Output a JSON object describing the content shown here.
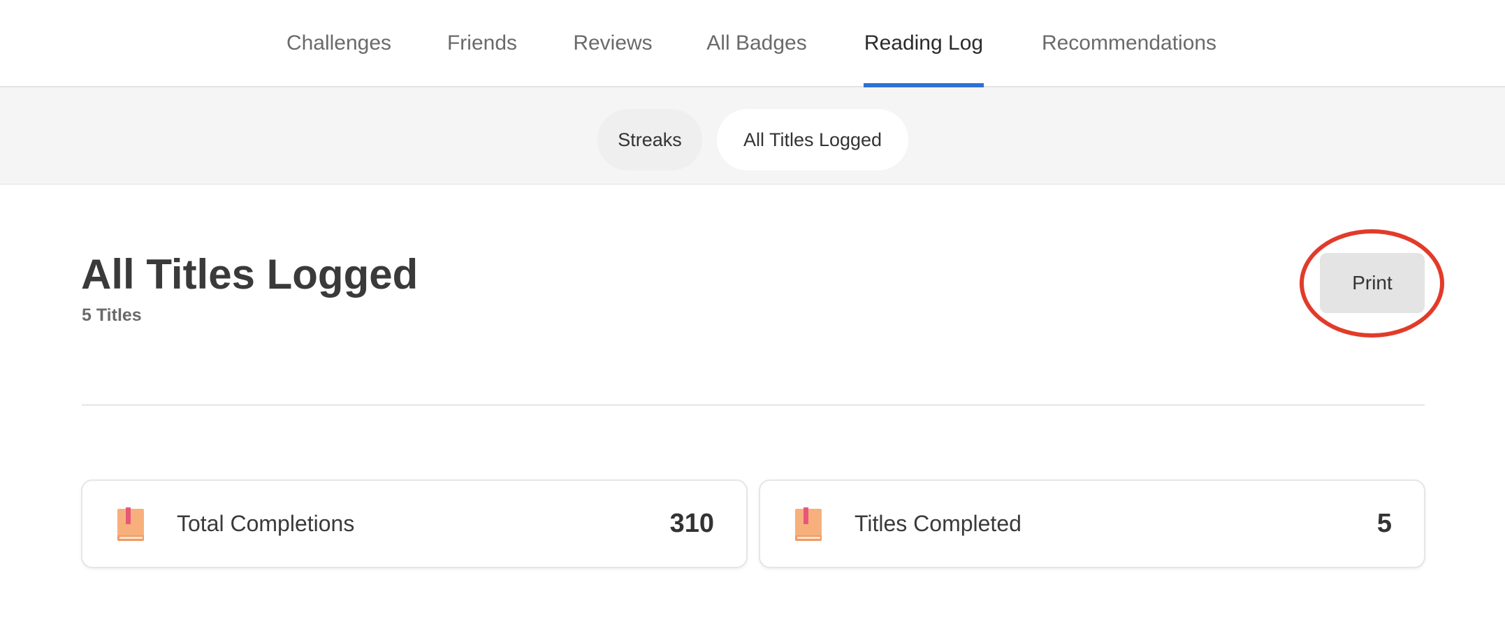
{
  "top_nav": {
    "tabs": [
      {
        "label": "Challenges",
        "active": false
      },
      {
        "label": "Friends",
        "active": false
      },
      {
        "label": "Reviews",
        "active": false
      },
      {
        "label": "All Badges",
        "active": false
      },
      {
        "label": "Reading Log",
        "active": true
      },
      {
        "label": "Recommendations",
        "active": false
      }
    ],
    "active_indicator_color": "#2f6fd6"
  },
  "sub_nav": {
    "pills": [
      {
        "label": "Streaks",
        "active": false
      },
      {
        "label": "All Titles Logged",
        "active": true
      }
    ]
  },
  "page": {
    "title": "All Titles Logged",
    "subtitle": "5 Titles",
    "print_label": "Print",
    "highlight_color": "#e23b2a"
  },
  "stats": [
    {
      "label": "Total Completions",
      "value": "310",
      "icon": "book-icon"
    },
    {
      "label": "Titles Completed",
      "value": "5",
      "icon": "book-icon"
    }
  ]
}
